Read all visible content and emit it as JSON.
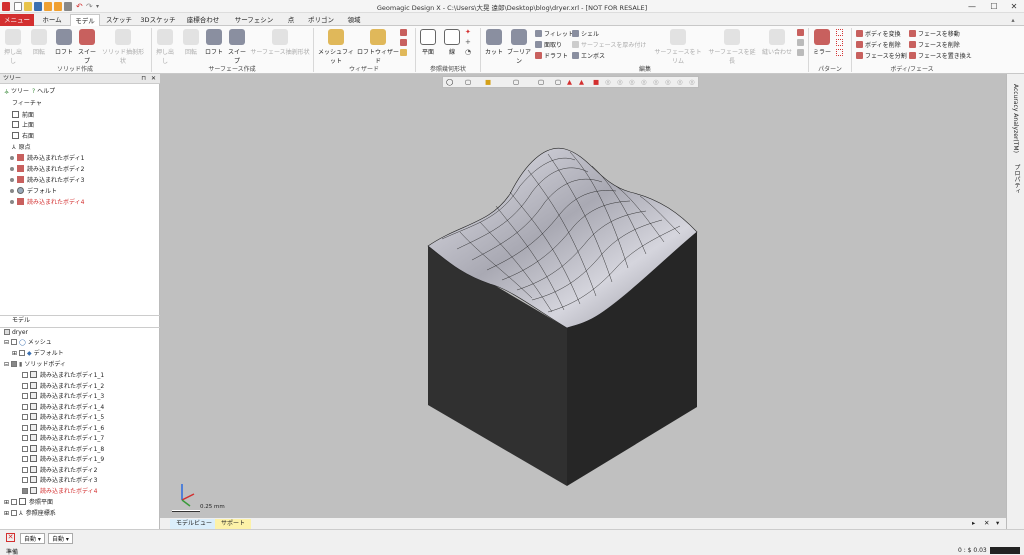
{
  "window": {
    "title": "Geomagic Design X - C:\\Users\\大晃 遠郎\\Desktop\\blog\\dryer.xrl - [NOT FOR RESALE]"
  },
  "tabs": [
    "メニュー",
    "ホーム",
    "モデル",
    "スケッチ",
    "3Dスケッチ",
    "座標合わせ",
    "サーフェシング",
    "点",
    "ポリゴン",
    "領域"
  ],
  "ribbon": {
    "solid_group": {
      "label": "ソリッド作成",
      "buttons": [
        "押し出し",
        "回転",
        "ロフト",
        "スイープ",
        "ソリッド抽剝形状"
      ]
    },
    "surface_group": {
      "label": "サーフェース作成",
      "buttons": [
        "押し出し",
        "回転",
        "ロフト",
        "スイープ",
        "サーフェース抽剝形状"
      ]
    },
    "wizard_group": {
      "label": "ウィザード",
      "buttons": [
        "メッシュフィット",
        "ロフトウィザード"
      ]
    },
    "ref_group": {
      "label": "参照幾何形状",
      "buttons": [
        "平面",
        "線"
      ]
    },
    "edit_group": {
      "label": "編集",
      "buttons": [
        "カット",
        "ブーリアン"
      ],
      "small": [
        "フィレット",
        "面取り",
        "ドラフト",
        "シェル",
        "サーフェースを厚み付け",
        "エンボス"
      ],
      "disabled": [
        "サーフェースをトリム",
        "サーフェースを延長",
        "縫い合わせ"
      ]
    },
    "pattern_group": {
      "label": "パターン",
      "buttons": [
        "ミラー"
      ]
    },
    "body_group": {
      "label": "ボディ/フェース",
      "items": [
        "ボディを変換",
        "ボディを削除",
        "フェースを分割",
        "フェースを移動",
        "フェースを削除",
        "フェースを置き換え"
      ]
    }
  },
  "tree_panel": {
    "title": "ツリー",
    "tabs": [
      "ツリー",
      "ヘルプ"
    ],
    "feature_header": "フィーチャ",
    "features": [
      {
        "label": "前面",
        "red": false
      },
      {
        "label": "上面",
        "red": false
      },
      {
        "label": "右面",
        "red": false
      },
      {
        "label": "原点",
        "red": false
      },
      {
        "label": "読み込まれたボディ1",
        "red": false
      },
      {
        "label": "読み込まれたボディ2",
        "red": false
      },
      {
        "label": "読み込まれたボディ3",
        "red": false
      },
      {
        "label": "デフォルト",
        "red": false
      },
      {
        "label": "読み込まれたボディ4",
        "red": true
      }
    ]
  },
  "model_panel": {
    "title": "モデル",
    "root": "dryer",
    "mesh": "メッシュ",
    "mesh_child": "デフォルト",
    "solid": "ソリッドボディ",
    "bodies": [
      {
        "label": "読み込まれたボディ1_1",
        "red": false
      },
      {
        "label": "読み込まれたボディ1_2",
        "red": false
      },
      {
        "label": "読み込まれたボディ1_3",
        "red": false
      },
      {
        "label": "読み込まれたボディ1_4",
        "red": false
      },
      {
        "label": "読み込まれたボディ1_5",
        "red": false
      },
      {
        "label": "読み込まれたボディ1_6",
        "red": false
      },
      {
        "label": "読み込まれたボディ1_7",
        "red": false
      },
      {
        "label": "読み込まれたボディ1_8",
        "red": false
      },
      {
        "label": "読み込まれたボディ1_9",
        "red": false
      },
      {
        "label": "読み込まれたボディ2",
        "red": false
      },
      {
        "label": "読み込まれたボディ3",
        "red": false
      },
      {
        "label": "読み込まれたボディ4",
        "red": true
      }
    ],
    "ref_plane": "参照平面",
    "ref_coord": "参照座標系"
  },
  "viewport": {
    "scale_label": "0.25 mm"
  },
  "right_dock": {
    "tab1": "Accuracy Analyzer(TM)",
    "tab2": "プロパティ"
  },
  "bottom_tabs": [
    "モデルビュー",
    "サポート"
  ],
  "status": {
    "left": "準備",
    "mode1": "自動",
    "mode2": "自動",
    "right": "0 : $ 0.03"
  },
  "colors": {
    "accent": "#d32f2f",
    "viewport_bg": "#c0c0c0"
  }
}
